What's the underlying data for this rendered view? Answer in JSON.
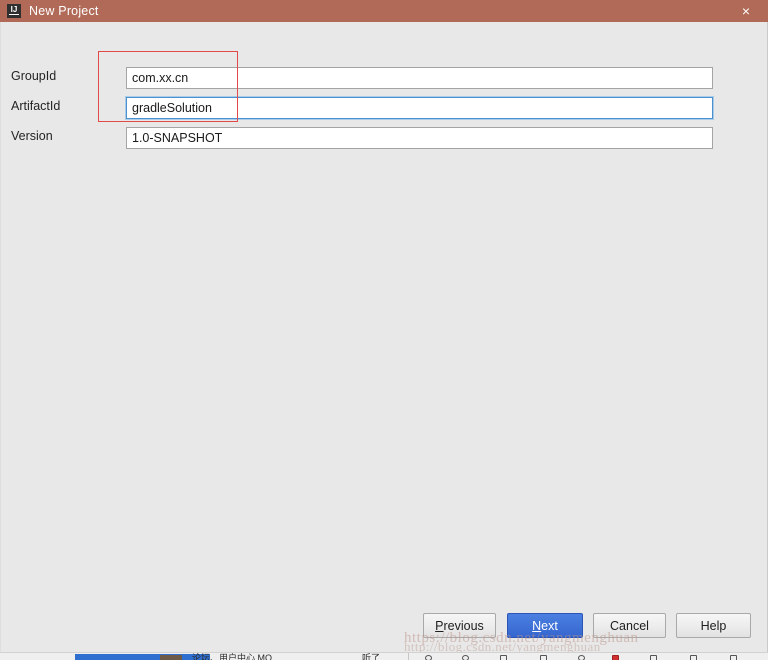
{
  "window": {
    "title": "New Project",
    "app_icon": "intellij-idea-icon",
    "icon_text": "IJ",
    "close_icon": "×",
    "titlebar_color": "#b06a57",
    "body_color": "#e8e8e8"
  },
  "form": {
    "fields": [
      {
        "label": "GroupId",
        "value": "com.xx.cn",
        "focused": false
      },
      {
        "label": "ArtifactId",
        "value": "gradleSolution",
        "focused": true
      },
      {
        "label": "Version",
        "value": "1.0-SNAPSHOT",
        "focused": false
      }
    ]
  },
  "annotation": {
    "shape": "rectangle",
    "color": "#e24a4a",
    "covers": "GroupId and ArtifactId value area"
  },
  "footer": {
    "buttons": [
      {
        "label": "Previous",
        "mnemonic": "P",
        "primary": false
      },
      {
        "label": "Next",
        "mnemonic": "N",
        "primary": true
      },
      {
        "label": "Cancel",
        "mnemonic": "",
        "primary": false
      },
      {
        "label": "Help",
        "mnemonic": "",
        "primary": false
      }
    ],
    "primary_color": "#3566cf"
  },
  "watermark": {
    "line1": "https://blog.csdn.net/yangmenghuan",
    "line2": "http://blog.csdn.net/yangmenghuan"
  },
  "taskbar": {
    "item_text": "论坛、用户中心 MQ",
    "item_text2": "听了"
  }
}
